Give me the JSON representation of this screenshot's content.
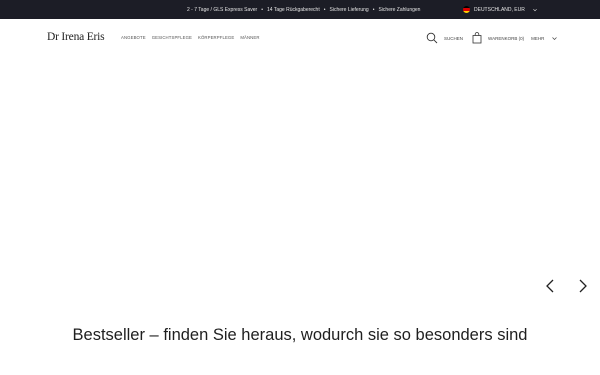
{
  "topbar": {
    "promo_items": [
      "2 - 7 Tage / GLS Express Saver",
      "14 Tage Rückgaberecht",
      "Sichere Lieferung",
      "Sichere Zahlungen"
    ],
    "separator": "•",
    "locale_label": "DEUTSCHLAND, EUR",
    "flag_colors": [
      "#000000",
      "#dd0000",
      "#ffce00"
    ]
  },
  "header": {
    "logo_text": "Dr Irena Eris",
    "nav_items": [
      "ANGEBOTE",
      "GESICHTSPFLEGE",
      "KÖRPERPFLEGE",
      "MÄNNER"
    ],
    "search_label": "SUCHEN",
    "cart_label": "WARENKORB (0)",
    "menu_label": "MEHR"
  },
  "hero": {
    "prev_icon": "chevron-left-icon",
    "next_icon": "chevron-right-icon"
  },
  "section": {
    "headline": "Bestseller – finden Sie heraus, wodurch sie so besonders sind"
  }
}
